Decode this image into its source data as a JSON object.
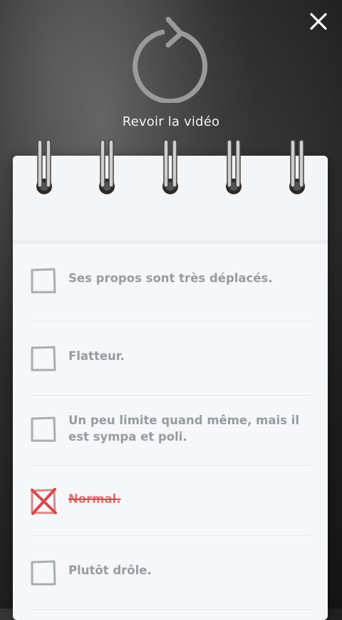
{
  "replay": {
    "label": "Revoir la vidéo"
  },
  "checklist": {
    "items": [
      {
        "label": "Ses propos sont très déplacés.",
        "checked": false
      },
      {
        "label": "Flatteur.",
        "checked": false
      },
      {
        "label": "Un peu limite quand même, mais il est sympa et poli.",
        "checked": false
      },
      {
        "label": "Normal.",
        "checked": true
      },
      {
        "label": "Plutôt drôle.",
        "checked": false
      }
    ]
  },
  "colors": {
    "checked_accent": "#d94848",
    "item_text": "#979ba3",
    "paper": "#f6f7f9"
  },
  "icons": {
    "close": "close-icon",
    "replay": "replay-icon",
    "checkbox": "checkbox-icon",
    "checked": "checkbox-checked-icon"
  }
}
